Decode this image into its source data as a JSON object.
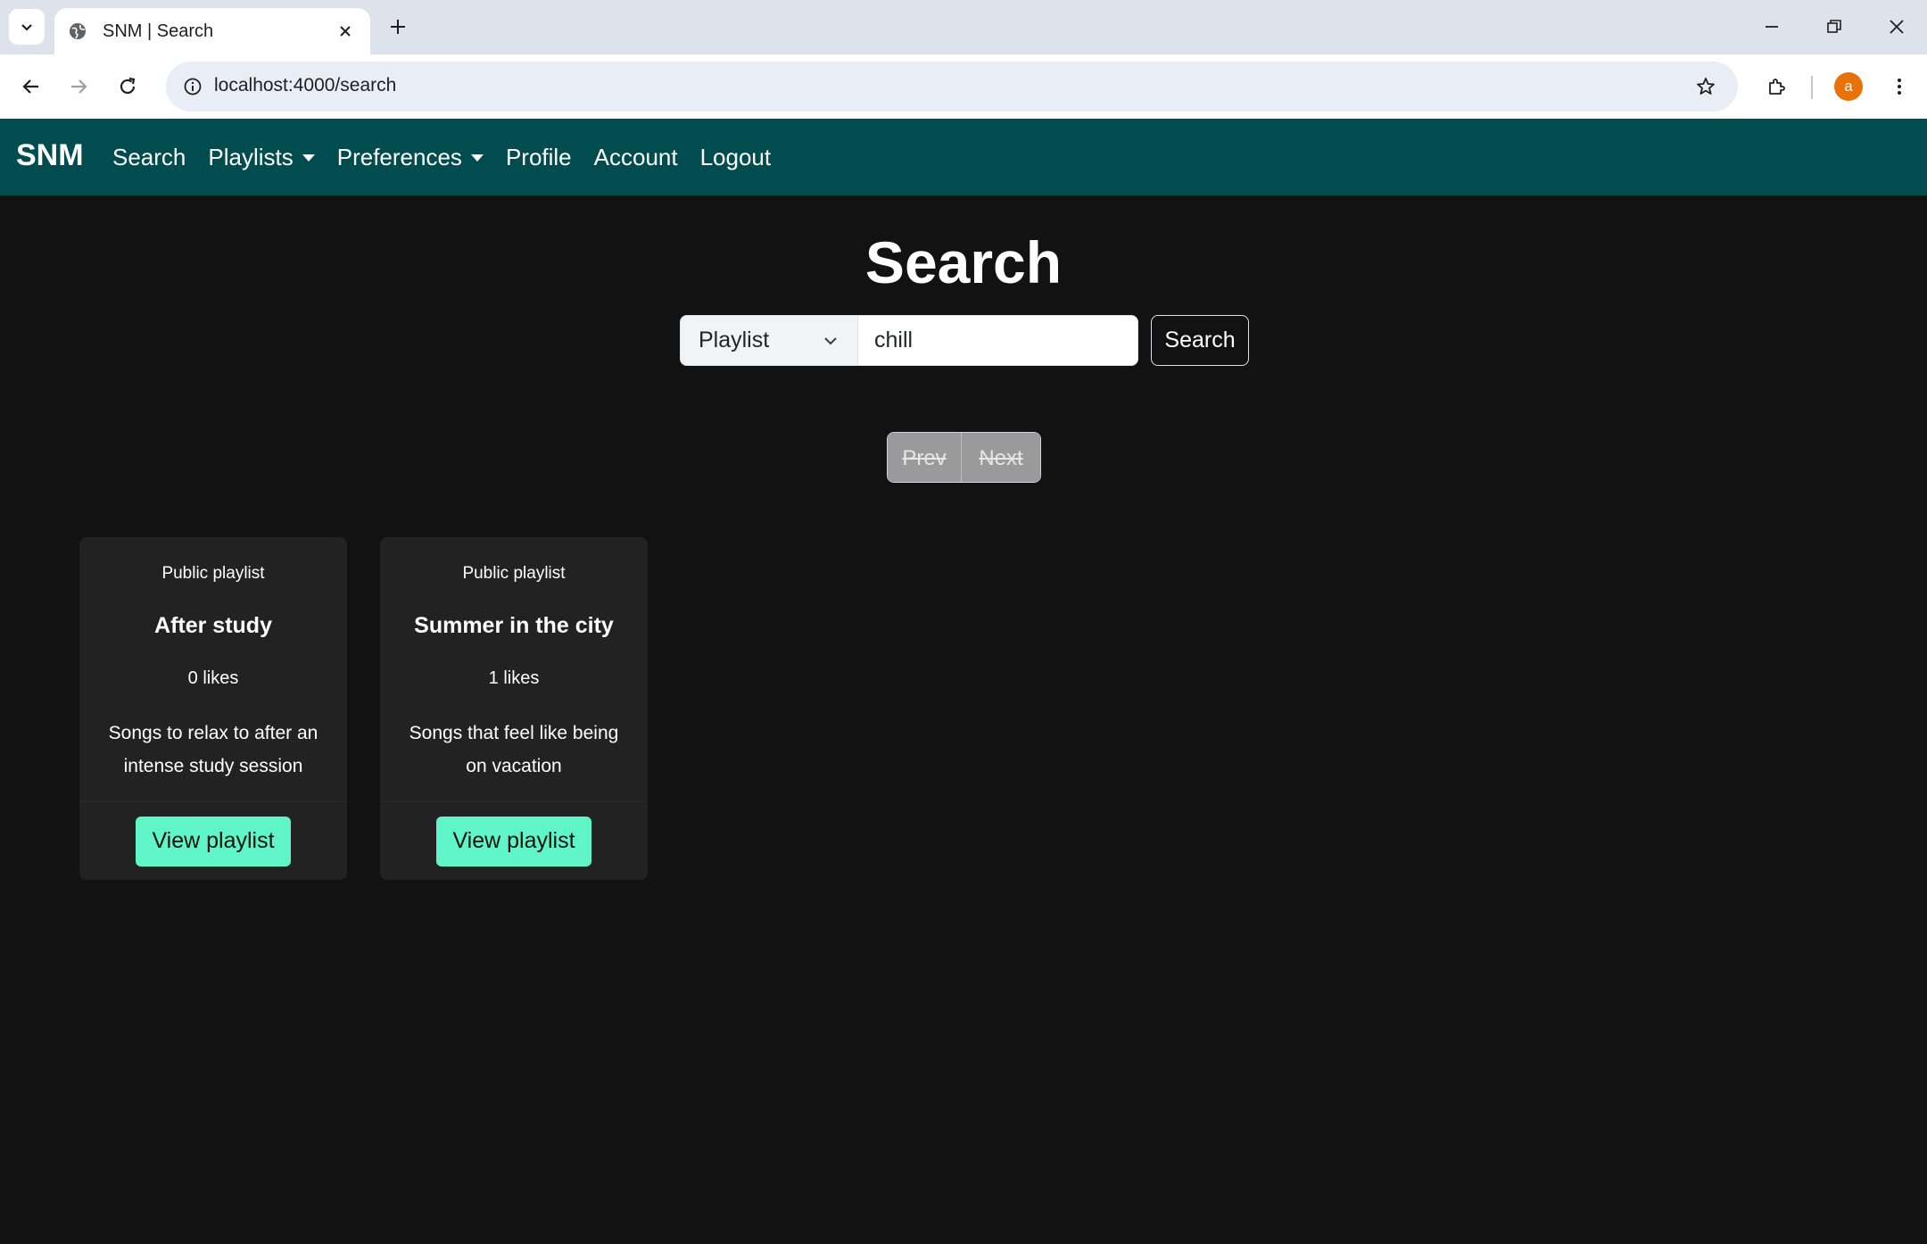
{
  "browser": {
    "tab_title": "SNM | Search",
    "url": "localhost:4000/search",
    "profile_initial": "a"
  },
  "navbar": {
    "brand": "SNM",
    "links": [
      {
        "label": "Search",
        "dropdown": false
      },
      {
        "label": "Playlists",
        "dropdown": true
      },
      {
        "label": "Preferences",
        "dropdown": true
      },
      {
        "label": "Profile",
        "dropdown": false
      },
      {
        "label": "Account",
        "dropdown": false
      },
      {
        "label": "Logout",
        "dropdown": false
      }
    ],
    "background": "#004c4f"
  },
  "main": {
    "title": "Search",
    "search": {
      "type_selected": "Playlist",
      "query_value": "chill",
      "button_label": "Search"
    },
    "pager": {
      "prev_label": "Prev",
      "next_label": "Next"
    },
    "results": [
      {
        "subtitle": "Public playlist",
        "title": "After study",
        "likes": "0 likes",
        "description": "Songs to relax to after an intense study session",
        "button_label": "View playlist"
      },
      {
        "subtitle": "Public playlist",
        "title": "Summer in the city",
        "likes": "1 likes",
        "description": "Songs that feel like being on vacation",
        "button_label": "View playlist"
      }
    ]
  },
  "colors": {
    "page_bg": "#121212",
    "card_bg": "#222222",
    "accent_button": "#5ff5c9"
  }
}
